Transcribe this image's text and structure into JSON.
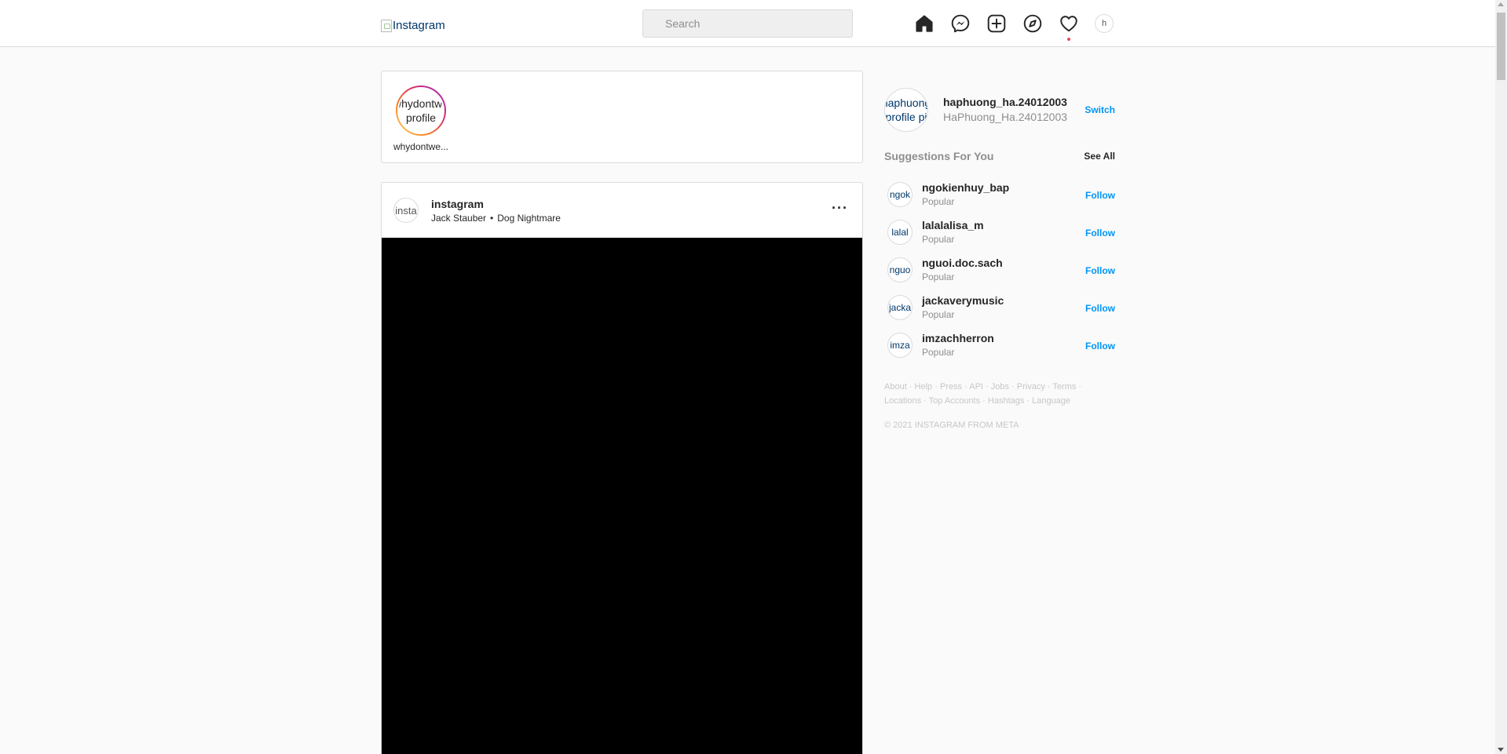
{
  "header": {
    "logo_alt": "Instagram",
    "search": {
      "placeholder": "Search",
      "value": ""
    },
    "nav_icons": [
      "home-icon",
      "messenger-icon",
      "new-post-icon",
      "explore-icon",
      "activity-heart-icon",
      "profile-avatar"
    ],
    "profile_avatar_alt": "h"
  },
  "stories": [
    {
      "avatar_alt": "whydontwe profile",
      "username": "whydontwe..."
    }
  ],
  "post": {
    "avatar_alt": "insta",
    "username": "instagram",
    "music_artist": "Jack Stauber",
    "separator": "•",
    "music_title": "Dog Nightmare",
    "more_icon": "more-options-icon"
  },
  "sidebar": {
    "me": {
      "avatar_alt": "haphuong profile pi",
      "username": "haphuong_ha.24012003",
      "full_name": "HaPhuong_Ha.24012003",
      "switch_label": "Switch"
    },
    "suggestions_title": "Suggestions For You",
    "see_all_label": "See All",
    "suggestions": [
      {
        "avatar_alt": "ngok",
        "username": "ngokienhuy_bap",
        "subtitle": "Popular",
        "follow_label": "Follow"
      },
      {
        "avatar_alt": "lalal",
        "username": "lalalalisa_m",
        "subtitle": "Popular",
        "follow_label": "Follow"
      },
      {
        "avatar_alt": "nguo",
        "username": "nguoi.doc.sach",
        "subtitle": "Popular",
        "follow_label": "Follow"
      },
      {
        "avatar_alt": "jacka",
        "username": "jackaverymusic",
        "subtitle": "Popular",
        "follow_label": "Follow"
      },
      {
        "avatar_alt": "imza",
        "username": "imzachherron",
        "subtitle": "Popular",
        "follow_label": "Follow"
      }
    ],
    "footer_links": [
      "About",
      "Help",
      "Press",
      "API",
      "Jobs",
      "Privacy",
      "Terms",
      "Locations",
      "Top Accounts",
      "Hashtags",
      "Language"
    ],
    "copyright": "© 2021 INSTAGRAM FROM META"
  },
  "colors": {
    "accent": "#0095f6",
    "notification_dot": "#ed4956",
    "border": "#dbdbdb",
    "muted_text": "#8e8e8e"
  }
}
